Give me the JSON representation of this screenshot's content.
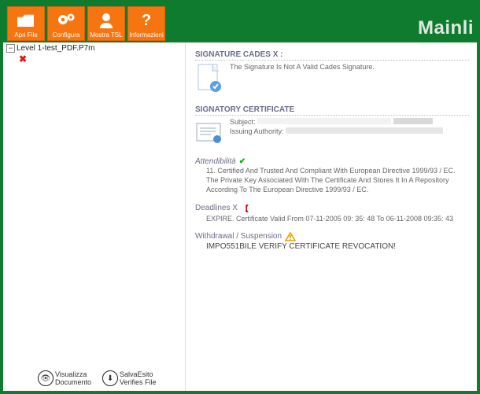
{
  "toolbar": {
    "open_label": "Apri File",
    "configure_label": "Configura",
    "showtsl_label": "Mostra TSL",
    "info_label": "Informazioni"
  },
  "watermark": "Mainli",
  "tree": {
    "root": "Level 1-test_PDF.P7m",
    "child_selected": " "
  },
  "side_buttons": {
    "view_doc": "Visualizza\nDocumento",
    "save_result": "SalvaEsito",
    "verify_file": "Verifies File"
  },
  "signature": {
    "title": "SIGNATURE CADES X :",
    "msg": "The Signature Is Not A Valid Cades Signature."
  },
  "cert": {
    "title": "SIGNATORY CERTIFICATE",
    "subject_label": "Subject:",
    "issuer_label": "Issuing Authority:"
  },
  "reliability": {
    "title": "Attendibilità",
    "line1": "11. Certified And Trusted And Compliant With European Directive 1999/93 / EC.",
    "line2": "The Private Key Associated With The Certificate And Stores It In A Repository",
    "line3": "According To The European Directive 1999/93 / EC."
  },
  "deadlines": {
    "title": "Deadlines X",
    "line": "EXPIRE. Certificate Valid From 07-11-2005 09: 35: 48 To 06-11-2008 09:35: 43"
  },
  "suspension": {
    "title": "Withdrawal / Suspension",
    "line": "IMPO551BILE VERIFY CERTIFICATE REVOCATION!"
  }
}
